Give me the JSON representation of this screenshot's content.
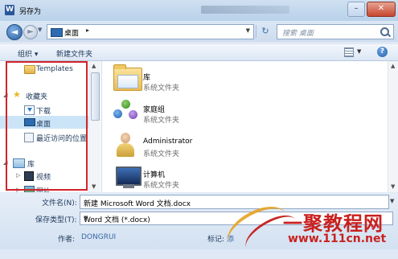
{
  "window": {
    "app_icon_letter": "W",
    "title": "另存为"
  },
  "nav": {
    "address_location": "桌面",
    "address_sep": "▸",
    "search_placeholder": "搜索 桌面",
    "back_glyph": "◄",
    "forward_glyph": "►",
    "refresh_glyph": "↻",
    "dropdown_glyph": "▼"
  },
  "toolbar": {
    "organize": "组织 ▾",
    "new_folder": "新建文件夹",
    "help_glyph": "?"
  },
  "nav_pane": {
    "items": [
      {
        "label": "Templates",
        "icon": "folder-icon"
      },
      {
        "label": "收藏夹",
        "icon": "star-icon"
      },
      {
        "label": "下载",
        "icon": "download-icon"
      },
      {
        "label": "桌面",
        "icon": "desktop-icon",
        "selected": true
      },
      {
        "label": "最近访问的位置",
        "icon": "recent-places-icon"
      },
      {
        "label": "库",
        "icon": "library-icon"
      },
      {
        "label": "视频",
        "icon": "video-icon"
      },
      {
        "label": "图片",
        "icon": "picture-icon"
      }
    ]
  },
  "files": [
    {
      "name": "库",
      "type": "系统文件夹",
      "icon": "library-folder-icon"
    },
    {
      "name": "家庭组",
      "type": "系统文件夹",
      "icon": "homegroup-icon"
    },
    {
      "name": "Administrator",
      "type": "系统文件夹",
      "icon": "user-folder-icon"
    },
    {
      "name": "计算机",
      "type": "系统文件夹",
      "icon": "computer-icon"
    }
  ],
  "form": {
    "filename_label": "文件名(N):",
    "filename_value": "新建 Microsoft Word 文档.docx",
    "filetype_label": "保存类型(T):",
    "filetype_value": "Word 文档 (*.docx)",
    "author_label": "作者:",
    "author_value": "DONGRUI",
    "tags_label": "标记:",
    "tags_value": "添"
  },
  "watermark": {
    "text": "一聚教程网",
    "url": "www.111cn.net"
  },
  "colors": {
    "highlight_box": "#d2232a",
    "selection": "#cce4f7",
    "link_blue": "#3b68a6"
  }
}
